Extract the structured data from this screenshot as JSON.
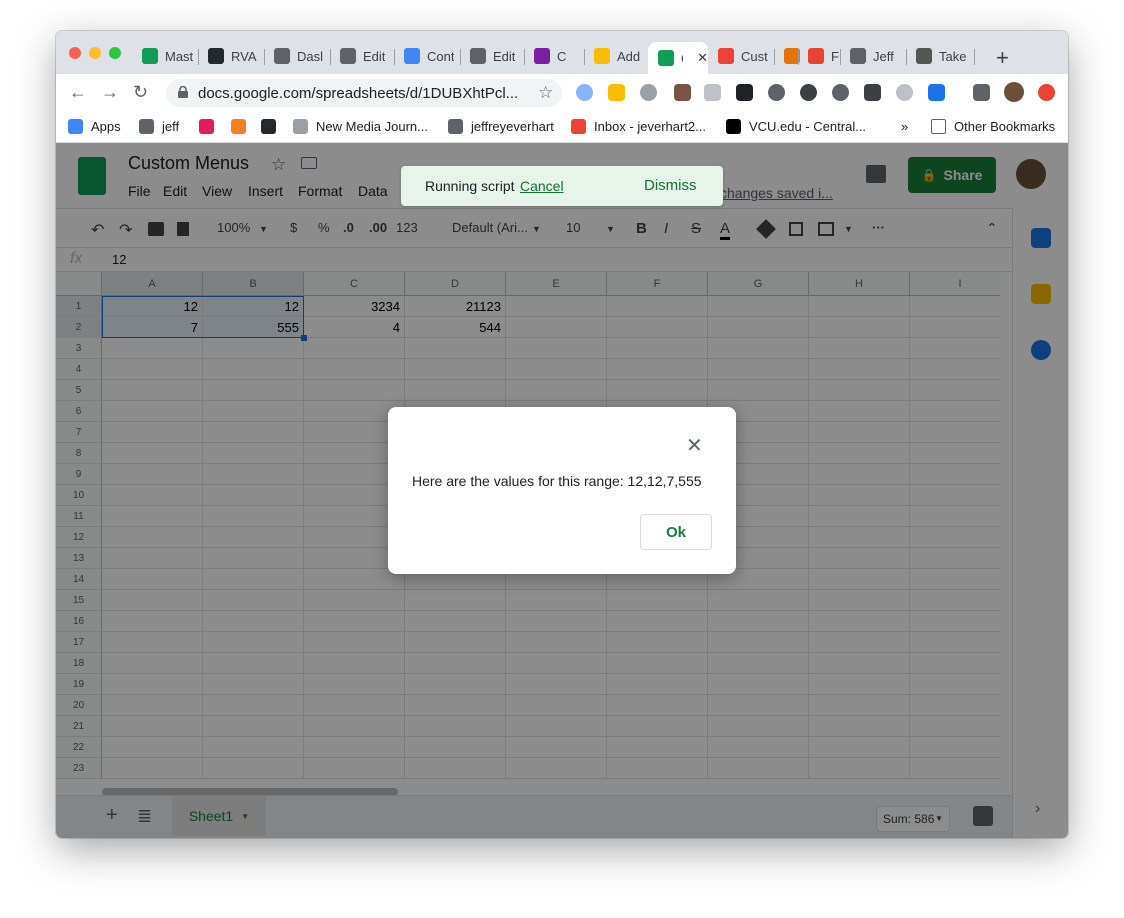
{
  "browser": {
    "tabs": [
      {
        "label": "Mast",
        "icon": "sheets-icon",
        "color": "#0f9d58"
      },
      {
        "label": "RVA",
        "icon": "github-icon",
        "color": "#24292e"
      },
      {
        "label": "Dasl",
        "icon": "globe-icon",
        "color": "#5f6368"
      },
      {
        "label": "Edit",
        "icon": "globe-icon",
        "color": "#5f6368"
      },
      {
        "label": "Cont",
        "icon": "code-icon",
        "color": "#4285f4"
      },
      {
        "label": "Edit",
        "icon": "globe-icon",
        "color": "#5f6368"
      },
      {
        "label": "C",
        "icon": "app-icon",
        "color": "#7b1fa2"
      },
      {
        "label": "Add",
        "icon": "drive-icon",
        "color": "#fbbc04"
      },
      {
        "label": "C",
        "icon": "sheets-icon",
        "color": "#0f9d58"
      },
      {
        "label": "Cust",
        "icon": "script-icon",
        "color": "#ea4335"
      },
      {
        "label": "",
        "icon": "shield-icon",
        "color": "#e37400"
      },
      {
        "label": "F",
        "icon": "maps-pin-icon",
        "color": "#ea4335"
      },
      {
        "label": "Jeff",
        "icon": "globe-icon",
        "color": "#5f6368"
      },
      {
        "label": "Take",
        "icon": "apple-icon",
        "color": "#555"
      }
    ],
    "new_tab": "+",
    "url": "docs.google.com/spreadsheets/d/1DUBXhtPcl..."
  },
  "bookmarks": [
    {
      "label": "Apps",
      "color": "#4285f4"
    },
    {
      "label": "jeff",
      "color": "#5f6368"
    },
    {
      "label": "",
      "color": "#e01e5a"
    },
    {
      "label": "",
      "color": "#f48024"
    },
    {
      "label": "",
      "color": "#24292e"
    },
    {
      "label": "New Media Journ...",
      "color": "#9aa0a6"
    },
    {
      "label": "jeffreyeverhart",
      "color": "#5f6368"
    },
    {
      "label": "Inbox - jeverhart2...",
      "color": "#ea4335"
    },
    {
      "label": "VCU.edu - Central...",
      "color": "#000000"
    }
  ],
  "bookmarks_more": "»",
  "other_bookmarks": "Other Bookmarks",
  "sheets": {
    "title": "Custom Menus",
    "menu": [
      "File",
      "Edit",
      "View",
      "Insert",
      "Format",
      "Data"
    ],
    "saved_text": "changes saved i...",
    "share_label": "Share",
    "snackbar": {
      "text": "Running script",
      "cancel": "Cancel",
      "dismiss": "Dismiss"
    },
    "format_bar": {
      "zoom": "100%",
      "currency": "$",
      "percent": "%",
      "dec_less": ".0",
      "dec_more": ".00",
      "more_formats": "123",
      "font": "Default (Ari...",
      "size": "10",
      "bold": "B",
      "italic": "I",
      "strike": "S",
      "text_color": "A",
      "more": "···"
    },
    "formula_label": "fx",
    "formula_value": "12",
    "columns": [
      "A",
      "B",
      "C",
      "D",
      "E",
      "F",
      "G",
      "H",
      "I"
    ],
    "rows": [
      "1",
      "2",
      "3",
      "4",
      "5",
      "6",
      "7",
      "8",
      "9",
      "10",
      "11",
      "12",
      "13",
      "14",
      "15",
      "16",
      "17",
      "18",
      "19",
      "20",
      "21",
      "22",
      "23"
    ],
    "cells": [
      [
        "12",
        "12",
        "3234",
        "21123"
      ],
      [
        "7",
        "555",
        "4",
        "544"
      ]
    ],
    "sheet_tab": "Sheet1",
    "sum": "Sum: 586",
    "add_sheet": "+"
  },
  "modal": {
    "message": "Here are the values for this range: 12,12,7,555",
    "ok_label": "Ok",
    "close": "✕"
  }
}
